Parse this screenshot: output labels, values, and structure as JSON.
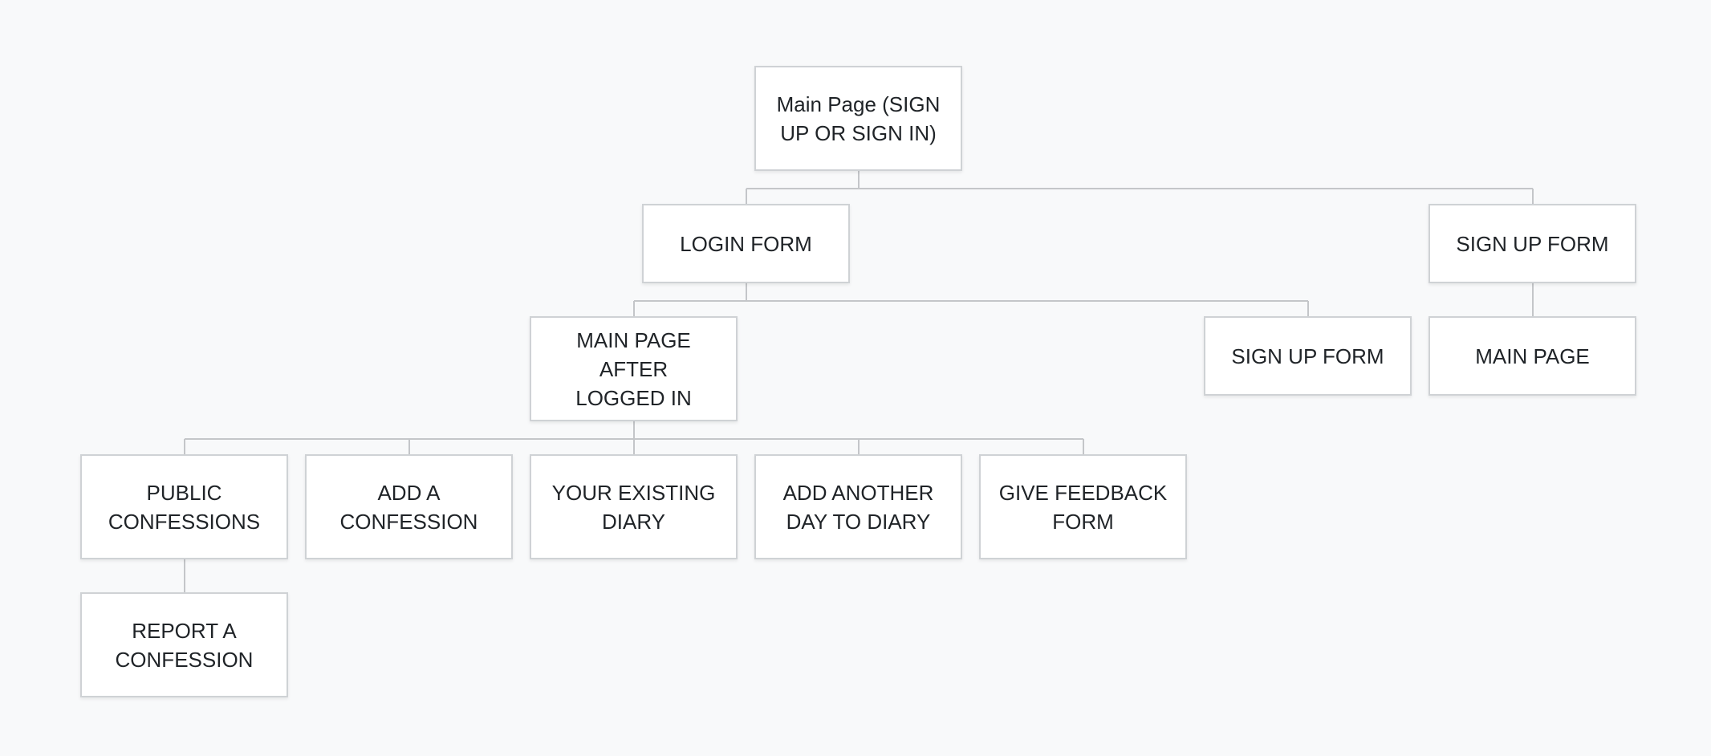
{
  "nodes": {
    "root": "Main Page (SIGN\nUP OR SIGN IN)",
    "login_form": "LOGIN FORM",
    "signup_form_top": "SIGN UP FORM",
    "main_after_login": "MAIN PAGE AFTER\nLOGGED IN",
    "signup_form_child": "SIGN UP FORM",
    "main_page": "MAIN PAGE",
    "public_confessions": "PUBLIC\nCONFESSIONS",
    "add_confession": "ADD A\nCONFESSION",
    "existing_diary": "YOUR EXISTING\nDIARY",
    "add_day_diary": "ADD ANOTHER\nDAY TO DIARY",
    "feedback_form": "GIVE FEEDBACK\nFORM",
    "report_confession": "REPORT A\nCONFESSION"
  }
}
